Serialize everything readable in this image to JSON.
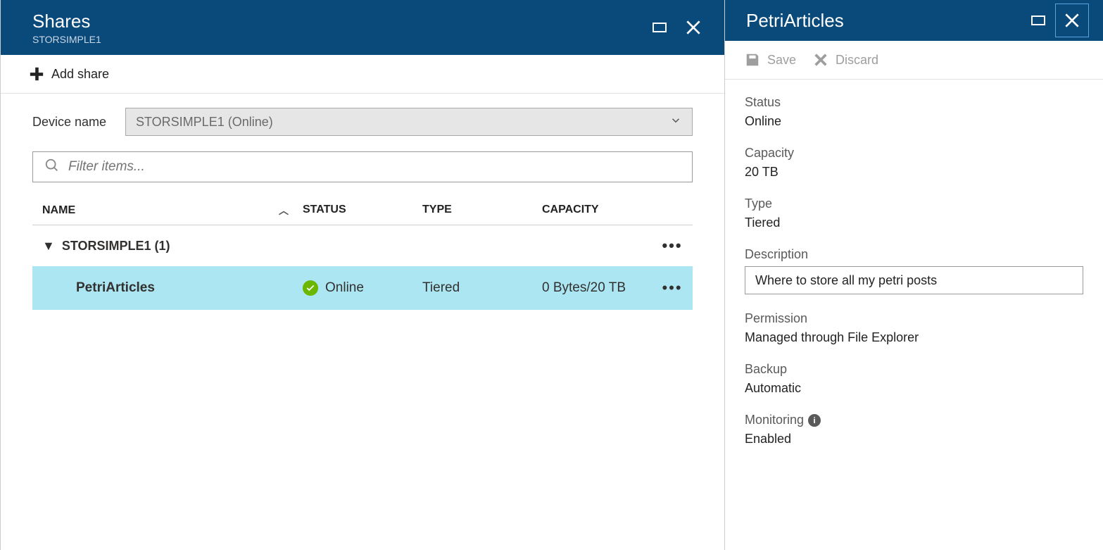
{
  "leftBlade": {
    "title": "Shares",
    "subtitle": "STORSIMPLE1",
    "toolbar": {
      "addShare": "Add share"
    },
    "deviceLabel": "Device name",
    "deviceSelect": "STORSIMPLE1 (Online)",
    "filterPlaceholder": "Filter items...",
    "columns": {
      "name": "NAME",
      "status": "STATUS",
      "type": "TYPE",
      "capacity": "CAPACITY"
    },
    "group": "STORSIMPLE1 (1)",
    "row": {
      "name": "PetriArticles",
      "status": "Online",
      "type": "Tiered",
      "capacity": "0 Bytes/20 TB"
    }
  },
  "rightBlade": {
    "title": "PetriArticles",
    "toolbar": {
      "save": "Save",
      "discard": "Discard"
    },
    "fields": {
      "statusLabel": "Status",
      "statusValue": "Online",
      "capacityLabel": "Capacity",
      "capacityValue": "20 TB",
      "typeLabel": "Type",
      "typeValue": "Tiered",
      "descriptionLabel": "Description",
      "descriptionValue": "Where to store all my petri posts",
      "permissionLabel": "Permission",
      "permissionValue": "Managed through File Explorer",
      "backupLabel": "Backup",
      "backupValue": "Automatic",
      "monitoringLabel": "Monitoring",
      "monitoringValue": "Enabled"
    }
  }
}
